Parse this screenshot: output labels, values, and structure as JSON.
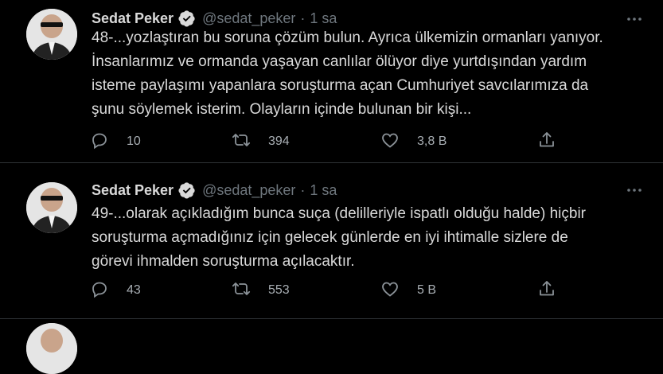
{
  "tweets": [
    {
      "name": "Sedat Peker",
      "handle": "@sedat_peker",
      "separator": "·",
      "time": "1 sa",
      "text": "48-...yozlaştıran bu soruna çözüm bulun. Ayrıca ülkemizin ormanları yanıyor.\nİnsanlarımız ve ormanda yaşayan canlılar ölüyor diye yurtdışından yardım\nisteme paylaşımı yapanlara soruşturma açan Cumhuriyet savcılarımıza da\nşunu söylemek isterim. Olayların içinde bulunan bir kişi...",
      "replies": "10",
      "retweets": "394",
      "likes": "3,8 B"
    },
    {
      "name": "Sedat Peker",
      "handle": "@sedat_peker",
      "separator": "·",
      "time": "1 sa",
      "text": "49-...olarak açıkladığım bunca suça (delilleriyle ispatlı olduğu halde) hiçbir\nsoruşturma açmadığınız için gelecek günlerde en iyi ihtimalle sizlere de\ngörevi ihmalden soruşturma açılacaktır.",
      "replies": "43",
      "retweets": "553",
      "likes": "5 B"
    }
  ],
  "colors": {
    "background": "#000000",
    "text": "#d9d9d9",
    "muted": "#6e767d",
    "verified": "#d9d9d9"
  },
  "icons": [
    "avatar",
    "verified-icon",
    "more-icon",
    "reply-icon",
    "retweet-icon",
    "like-icon",
    "share-icon"
  ]
}
